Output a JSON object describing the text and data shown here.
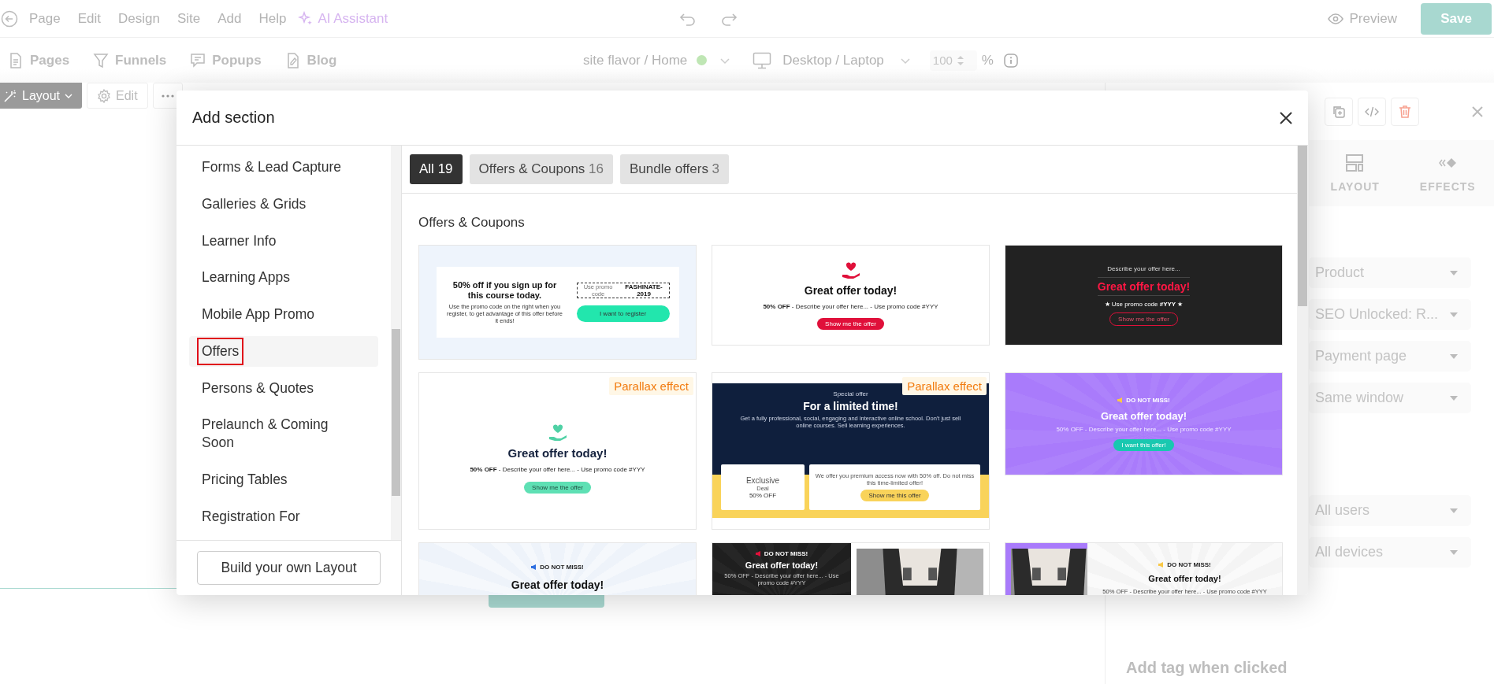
{
  "menu": {
    "items": [
      "Page",
      "Edit",
      "Design",
      "Site",
      "Add",
      "Help"
    ],
    "assistant": "AI Assistant"
  },
  "top_actions": {
    "preview": "Preview",
    "save": "Save"
  },
  "nav": [
    {
      "kind": "page",
      "label": "Pages"
    },
    {
      "kind": "funnel",
      "label": "Funnels"
    },
    {
      "kind": "popup",
      "label": "Popups"
    },
    {
      "kind": "blog",
      "label": "Blog"
    }
  ],
  "site": {
    "label": "site flavor / Home"
  },
  "device": {
    "label": "Desktop / Laptop"
  },
  "zoom": {
    "value": "100",
    "unit": "%"
  },
  "canvas_toolbar": [
    {
      "kind": "layout",
      "label": "Layout"
    },
    {
      "kind": "edit",
      "label": "Edit"
    },
    {
      "kind": "more"
    }
  ],
  "settings_panel": {
    "tabs": [
      {
        "kind": "layout",
        "label": "LAYOUT"
      },
      {
        "kind": "effects",
        "label": "EFFECTS"
      }
    ],
    "link_dropdowns": [
      {
        "value": "Product"
      },
      {
        "value": "SEO Unlocked: R..."
      },
      {
        "value": "Payment page"
      },
      {
        "value": "Same window"
      }
    ],
    "audience_dropdowns": [
      {
        "value": "All users"
      },
      {
        "value": "All devices"
      }
    ],
    "footer_label": "Add tag when clicked"
  },
  "modal": {
    "title": "Add section",
    "categories": [
      {
        "label": "Forms & Lead Capture",
        "selected": false
      },
      {
        "label": "Galleries & Grids",
        "selected": false
      },
      {
        "label": "Learner Info",
        "selected": false
      },
      {
        "label": "Learning Apps",
        "selected": false
      },
      {
        "label": "Mobile App Promo",
        "selected": false
      },
      {
        "label": "Offers",
        "selected": true
      },
      {
        "label": "Persons & Quotes",
        "selected": false
      },
      {
        "label": "Prelaunch & Coming Soon",
        "selected": false
      },
      {
        "label": "Pricing Tables",
        "selected": false
      },
      {
        "label": "Registration For",
        "selected": false
      }
    ],
    "build_button": "Build your own Layout",
    "filters": [
      {
        "label": "All",
        "count": "19",
        "selected": true
      },
      {
        "label": "Offers & Coupons",
        "count": "16",
        "selected": false
      },
      {
        "label": "Bundle offers",
        "count": "3",
        "selected": false
      }
    ],
    "section_title": "Offers & Coupons",
    "templates": [
      {
        "kind": "coupon",
        "heading": "50% off if you sign up for this course today.",
        "body": "Use the promo code on the right when you register, to get advantage of this offer before it ends!",
        "code_label": "Use promo code",
        "code": "FASHINATE-2019",
        "button": "I want to register"
      },
      {
        "kind": "light",
        "title": "Great offer today!",
        "line": "**50% OFF** - Describe your offer here... - Use promo code #YYY",
        "button": "Show me the offer"
      },
      {
        "kind": "dark",
        "eyebrow": "Describe your offer here...",
        "title": "Great offer today!",
        "line": "★ Use promo code **#YYY** ★",
        "button": "Show me the offer"
      },
      {
        "kind": "parallax",
        "badge": "Parallax effect",
        "title": "Great offer today!",
        "line": "**50% OFF** - Describe your offer here... - Use promo code #YYY",
        "button": "Show me the offer"
      },
      {
        "kind": "limited",
        "badge": "Parallax effect",
        "eyebrow": "Special offer",
        "title": "For a limited time!",
        "body": "Get a fully professional, social, engaging and interactive online school. Don't just sell online courses. Sell learning experiences.",
        "deal_title": "Exclusive",
        "deal_label": "Deal",
        "deal_value": "50% OFF",
        "offer_text": "We offer you premium access now with 50% off. Do not miss this time-limited offer!",
        "button": "Show me this offer"
      },
      {
        "kind": "purple",
        "eyebrow": "DO NOT MISS!",
        "title": "Great offer today!",
        "line": "50% OFF - Describe your offer here... - Use promo code #YYY",
        "button": "I want this offer!"
      },
      {
        "kind": "rays",
        "eyebrow": "DO NOT MISS!",
        "title": "Great offer today!"
      },
      {
        "kind": "dark-photo",
        "eyebrow": "DO NOT MISS!",
        "title": "Great offer today!",
        "line": "50% OFF - Describe your offer here... - Use promo code #YYY"
      },
      {
        "kind": "photo-light",
        "eyebrow": "DO NOT MISS!",
        "title": "Great offer today!",
        "line": "50% OFF - Describe your offer here... - Use promo code #YYY"
      }
    ]
  }
}
